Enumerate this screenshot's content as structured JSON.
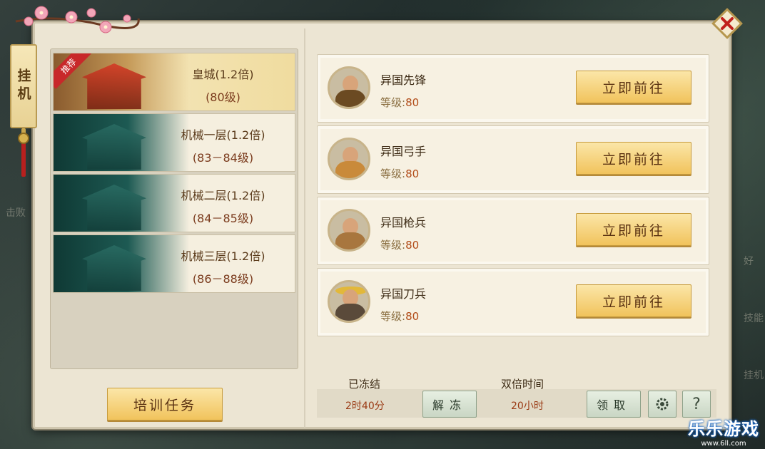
{
  "side_tab": {
    "label": "挂机"
  },
  "zones": [
    {
      "name": "皇城(1.2倍)",
      "level": "(80级)",
      "badge": "推荐",
      "selected": true
    },
    {
      "name": "机械一层(1.2倍)",
      "level": "(83－84级)",
      "selected": false
    },
    {
      "name": "机械二层(1.2倍)",
      "level": "(84－85级)",
      "selected": false
    },
    {
      "name": "机械三层(1.2倍)",
      "level": "(86－88级)",
      "selected": false
    }
  ],
  "enemies": [
    {
      "name": "异国先锋",
      "level_label": "等级:",
      "level": "80",
      "button": "立即前往"
    },
    {
      "name": "异国弓手",
      "level_label": "等级:",
      "level": "80",
      "button": "立即前往"
    },
    {
      "name": "异国枪兵",
      "level_label": "等级:",
      "level": "80",
      "button": "立即前往"
    },
    {
      "name": "异国刀兵",
      "level_label": "等级:",
      "level": "80",
      "button": "立即前往"
    }
  ],
  "bottom": {
    "train_button": "培训任务",
    "frozen_label": "已冻结",
    "frozen_value": "2时40分",
    "unfreeze_button": "解冻",
    "double_label": "双倍时间",
    "double_value": "20小时",
    "claim_button": "领取",
    "help_label": "?"
  },
  "watermark": {
    "title": "乐乐游戏",
    "url": "www.6ll.com"
  },
  "background_text": [
    "击败",
    "好",
    "技能",
    "挂机"
  ],
  "colors": {
    "accent": "#f1c35c",
    "panel": "#ece5d3",
    "ribbon": "#c8282a"
  }
}
